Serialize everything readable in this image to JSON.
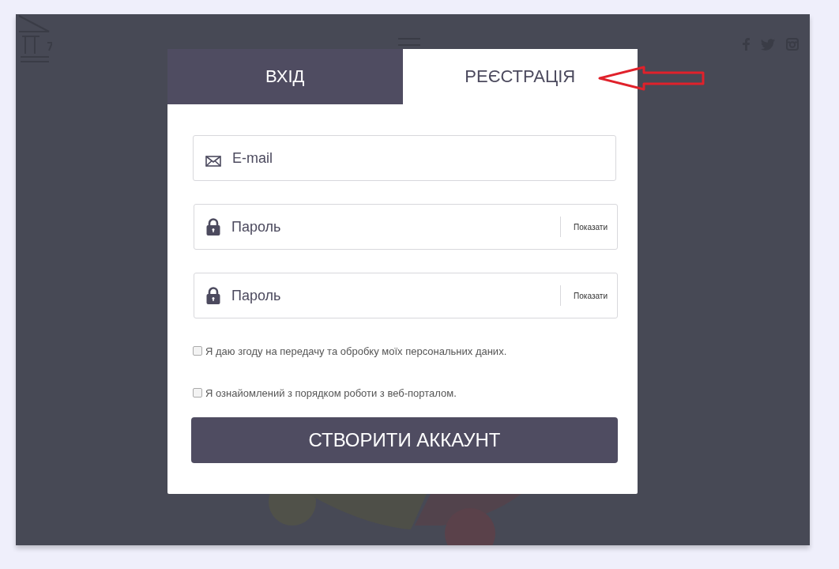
{
  "tabs": [
    {
      "label": "ВХІД",
      "selected": false
    },
    {
      "label": "РЕЄСТРАЦІЯ",
      "selected": true
    }
  ],
  "fields": [
    {
      "kind": "email",
      "placeholder": "E-mail"
    },
    {
      "kind": "password",
      "placeholder": "Пароль",
      "action": "Показати"
    },
    {
      "kind": "password",
      "placeholder": "Пароль",
      "action": "Показати"
    }
  ],
  "checkboxes": [
    {
      "label": "Я даю згоду на передачу та обробку моїх персональних даних.",
      "checked": false
    },
    {
      "label": "Я ознайомлений з порядком роботи з веб-порталом.",
      "checked": false
    }
  ],
  "submit": "СТВОРИТИ АККАУНТ"
}
